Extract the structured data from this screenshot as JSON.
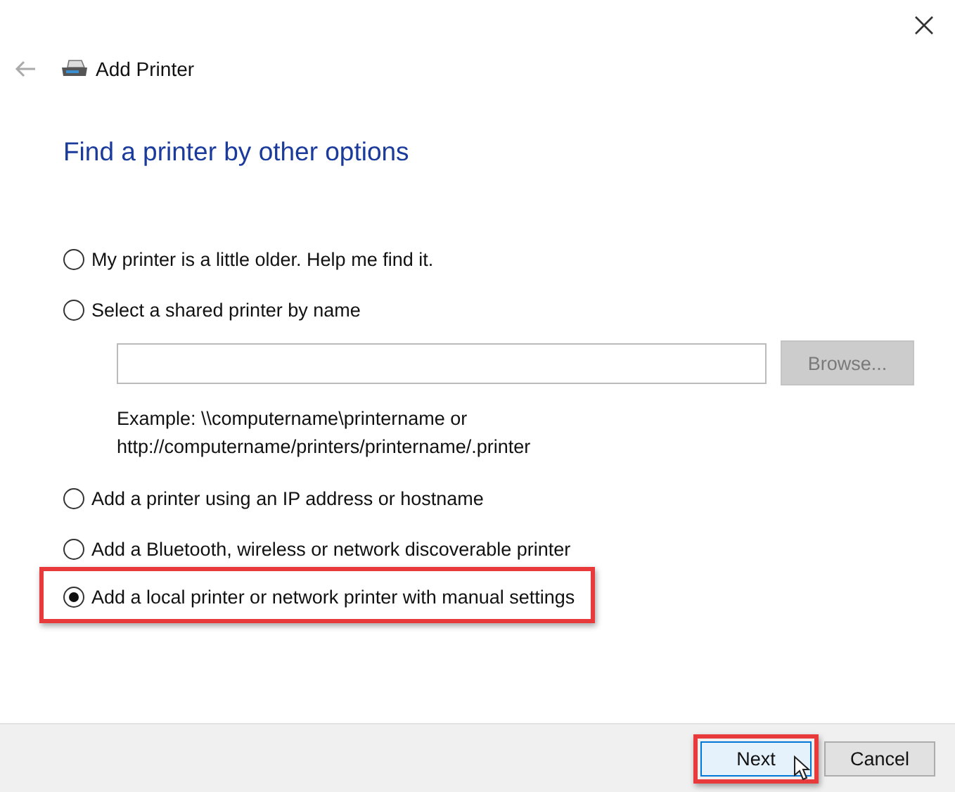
{
  "window": {
    "title": "Add Printer"
  },
  "heading": "Find a printer by other options",
  "options": [
    {
      "label": "My printer is a little older. Help me find it.",
      "selected": false,
      "highlighted": false
    },
    {
      "label": "Select a shared printer by name",
      "selected": false,
      "highlighted": false,
      "details": {
        "browse_button": {
          "label": "Browse...",
          "disabled": true
        },
        "example_lines": [
          "Example: \\\\computername\\printername or",
          "http://computername/printers/printername/.printer"
        ]
      }
    },
    {
      "label": "Add a printer using an IP address or hostname",
      "selected": false,
      "highlighted": false
    },
    {
      "label": "Add a Bluetooth, wireless or network discoverable printer",
      "selected": false,
      "highlighted": false
    },
    {
      "label": "Add a local printer or network printer with manual settings",
      "selected": true,
      "highlighted": true
    }
  ],
  "buttons": [
    {
      "label": "Next",
      "kind": "default",
      "highlighted": true,
      "hovered": true
    },
    {
      "label": "Cancel",
      "kind": "normal",
      "highlighted": false,
      "hovered": false
    }
  ]
}
